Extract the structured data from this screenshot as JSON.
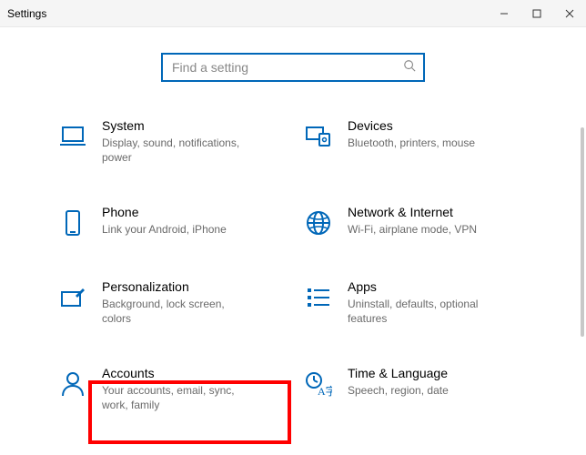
{
  "window": {
    "title": "Settings"
  },
  "search": {
    "placeholder": "Find a setting"
  },
  "tiles": {
    "system": {
      "label": "System",
      "desc": "Display, sound, notifications, power"
    },
    "devices": {
      "label": "Devices",
      "desc": "Bluetooth, printers, mouse"
    },
    "phone": {
      "label": "Phone",
      "desc": "Link your Android, iPhone"
    },
    "network": {
      "label": "Network & Internet",
      "desc": "Wi-Fi, airplane mode, VPN"
    },
    "personalization": {
      "label": "Personalization",
      "desc": "Background, lock screen, colors"
    },
    "apps": {
      "label": "Apps",
      "desc": "Uninstall, defaults, optional features"
    },
    "accounts": {
      "label": "Accounts",
      "desc": "Your accounts, email, sync, work, family"
    },
    "time": {
      "label": "Time & Language",
      "desc": "Speech, region, date"
    }
  }
}
